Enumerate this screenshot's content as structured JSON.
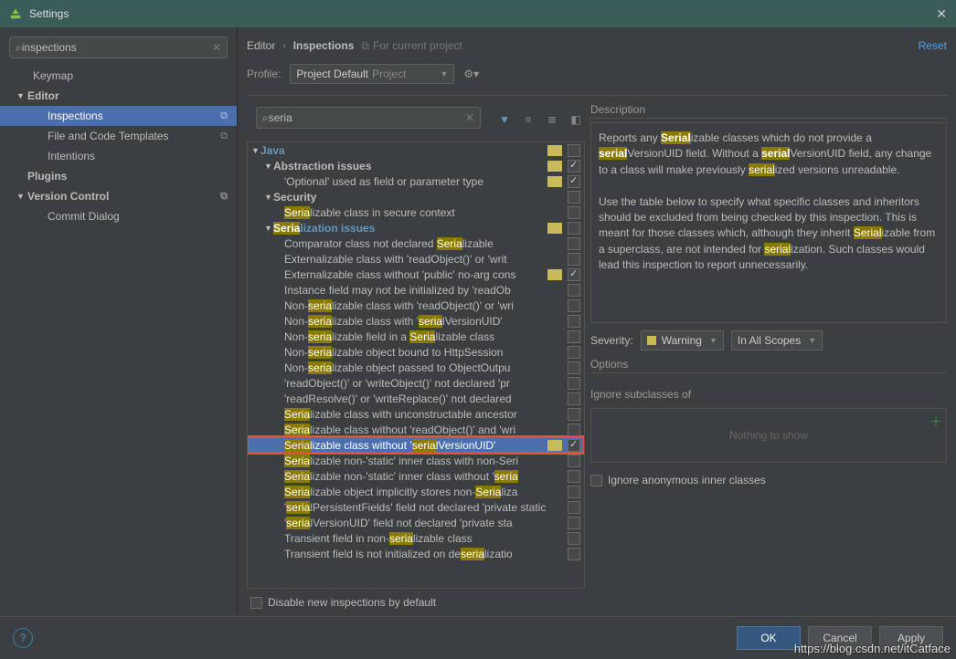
{
  "window_title": "Settings",
  "sidebar_search": "inspections",
  "sidebar": {
    "keymap": "Keymap",
    "editor": "Editor",
    "inspections": "Inspections",
    "file_tpl": "File and Code Templates",
    "intentions": "Intentions",
    "plugins": "Plugins",
    "vcs": "Version Control",
    "commit": "Commit Dialog"
  },
  "breadcrumb": {
    "editor": "Editor",
    "inspections": "Inspections",
    "tag": "For current project",
    "reset": "Reset"
  },
  "profile": {
    "label": "Profile:",
    "value": "Project Default",
    "ghost": "Project"
  },
  "insp_search": "seria",
  "tree": {
    "java": "Java",
    "abstraction": "Abstraction issues",
    "optional": "'Optional' used as field or parameter type",
    "security": "Security",
    "sec_serial": "Serializable class in secure context",
    "ser_issues": "Serialization issues",
    "rows": [
      "Comparator class not declared Serializable",
      "Externalizable class with 'readObject()' or 'writ",
      "Externalizable class without 'public' no-arg cons",
      "Instance field may not be initialized by 'readOb",
      "Non-serializable class with 'readObject()' or 'wri",
      "Non-serializable class with 'serialVersionUID'",
      "Non-serializable field in a Serializable class",
      "Non-serializable object bound to HttpSession",
      "Non-serializable object passed to ObjectOutpu",
      "'readObject()' or 'writeObject()' not declared 'pr",
      "'readResolve()' or 'writeReplace()' not declared",
      "Serializable class with unconstructable ancestor",
      "Serializable class without 'readObject()' and 'wri"
    ],
    "selected": "Serializable class without 'serialVersionUID'",
    "rows2": [
      "Serializable non-'static' inner class with non-Seri",
      "Serializable non-'static' inner class without 'seria",
      "Serializable object implicitly stores non-Serializa",
      "'serialPersistentFields' field not declared 'private static final ObjectStreamField[]'",
      "'serialVersionUID' field not declared 'private sta",
      "Transient field in non-serializable class",
      "Transient field is not initialized on deserializatio"
    ]
  },
  "disable_label": "Disable new inspections by default",
  "desc": {
    "label": "Description",
    "p1a": "Reports any ",
    "p1b": "Serial",
    "p1c": "izable classes which do not provide a ",
    "p2a": "serial",
    "p2b": "VersionUID field. Without a ",
    "p2c": "serial",
    "p2d": "VersionUID field, any change to a class will make previously ",
    "p2e": "serial",
    "p2f": "ized versions unreadable.",
    "p3a": "Use the table below to specify what specific classes and inheritors should be excluded from being checked by this inspection. This is meant for those classes which, although they inherit ",
    "p3b": "Serial",
    "p3c": "izable from a superclass, are not intended for ",
    "p3d": "serial",
    "p3e": "ization. Such classes would lead this inspection to report unnecessarily."
  },
  "severity": {
    "label": "Severity:",
    "warning": "Warning",
    "scope": "In All Scopes"
  },
  "options": {
    "label": "Options",
    "sub": "Ignore subclasses of",
    "empty": "Nothing to show",
    "anon": "Ignore anonymous inner classes"
  },
  "buttons": {
    "ok": "OK",
    "cancel": "Cancel",
    "apply": "Apply"
  },
  "watermark": "https://blog.csdn.net/itCatface"
}
